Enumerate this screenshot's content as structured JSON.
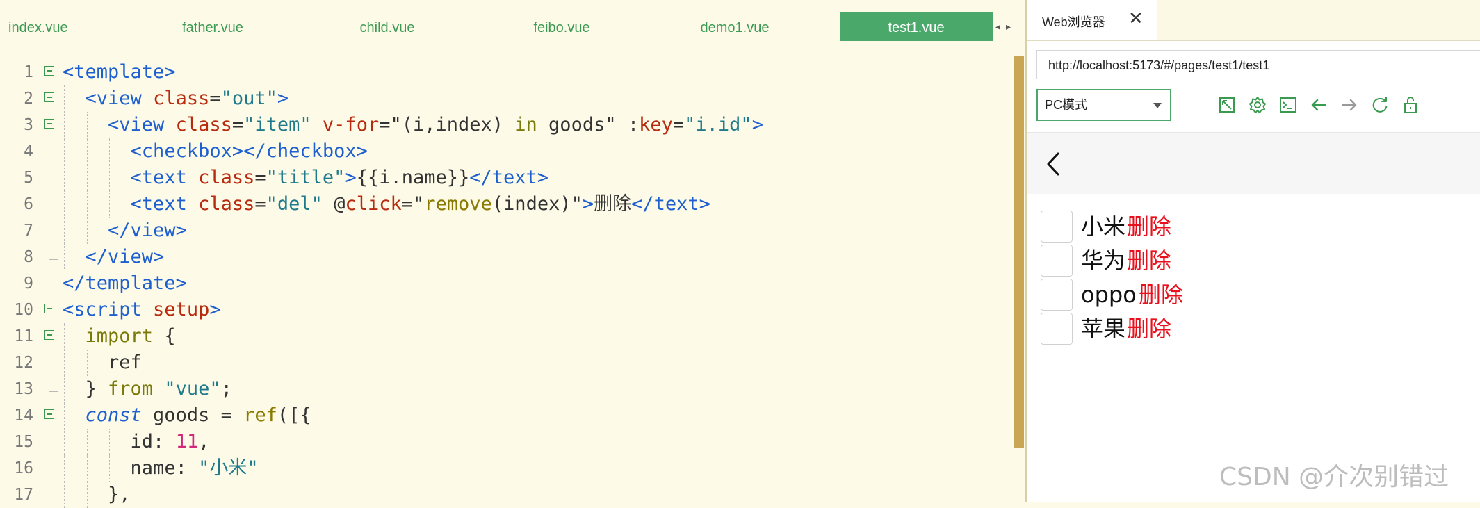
{
  "editor": {
    "tabs": [
      "index.vue",
      "father.vue",
      "child.vue",
      "feibo.vue",
      "demo1.vue",
      "test1.vue"
    ],
    "active_tab": "test1.vue",
    "tab_scroll_left": "◂",
    "tab_scroll_right": "▸",
    "line_numbers": [
      "1",
      "2",
      "3",
      "4",
      "5",
      "6",
      "7",
      "8",
      "9",
      "10",
      "11",
      "12",
      "13",
      "14",
      "15",
      "16",
      "17"
    ],
    "code_lines": [
      [
        [
          "t-tag",
          "<template>"
        ]
      ],
      [
        [
          "t-tag",
          "<view "
        ],
        [
          "t-attr",
          "class"
        ],
        [
          "t-txt",
          "="
        ],
        [
          "t-str",
          "\"out\""
        ],
        [
          "t-tag",
          ">"
        ]
      ],
      [
        [
          "t-tag",
          "<view "
        ],
        [
          "t-attr",
          "class"
        ],
        [
          "t-txt",
          "="
        ],
        [
          "t-str",
          "\"item\" "
        ],
        [
          "t-attr",
          "v-for"
        ],
        [
          "t-txt",
          "=\"(i,index) "
        ],
        [
          "t-kw",
          "in"
        ],
        [
          "t-txt",
          " goods\" :"
        ],
        [
          "t-attr",
          "key"
        ],
        [
          "t-txt",
          "="
        ],
        [
          "t-str",
          "\"i.id\""
        ],
        [
          "t-tag",
          ">"
        ]
      ],
      [
        [
          "t-tag",
          "<checkbox></checkbox>"
        ]
      ],
      [
        [
          "t-tag",
          "<text "
        ],
        [
          "t-attr",
          "class"
        ],
        [
          "t-txt",
          "="
        ],
        [
          "t-str",
          "\"title\""
        ],
        [
          "t-tag",
          ">"
        ],
        [
          "t-txt",
          "{{i.name}}"
        ],
        [
          "t-tag",
          "</text>"
        ]
      ],
      [
        [
          "t-tag",
          "<text "
        ],
        [
          "t-attr",
          "class"
        ],
        [
          "t-txt",
          "="
        ],
        [
          "t-str",
          "\"del\" "
        ],
        [
          "t-txt",
          "@"
        ],
        [
          "t-attr",
          "click"
        ],
        [
          "t-txt",
          "=\""
        ],
        [
          "t-fn",
          "remove"
        ],
        [
          "t-txt",
          "(index)\""
        ],
        [
          "t-tag",
          ">"
        ],
        [
          "t-txt",
          "删除"
        ],
        [
          "t-tag",
          "</text>"
        ]
      ],
      [
        [
          "t-tag",
          "</view>"
        ]
      ],
      [
        [
          "t-tag",
          "</view>"
        ]
      ],
      [
        [
          "t-tag",
          "</template>"
        ]
      ],
      [
        [
          "t-tag",
          "<script "
        ],
        [
          "t-attr",
          "setup"
        ],
        [
          "t-tag",
          ">"
        ]
      ],
      [
        [
          "t-kw",
          "import"
        ],
        [
          "t-txt",
          " {"
        ]
      ],
      [
        [
          "t-txt",
          "ref"
        ]
      ],
      [
        [
          "t-txt",
          "} "
        ],
        [
          "t-kw",
          "from"
        ],
        [
          "t-txt",
          " "
        ],
        [
          "t-str",
          "\"vue\""
        ],
        [
          "t-txt",
          ";"
        ]
      ],
      [
        [
          "t-const",
          "const"
        ],
        [
          "t-txt",
          " goods = "
        ],
        [
          "t-fn",
          "ref"
        ],
        [
          "t-txt",
          "([{"
        ]
      ],
      [
        [
          "t-txt",
          "id: "
        ],
        [
          "t-num",
          "11"
        ],
        [
          "t-txt",
          ","
        ]
      ],
      [
        [
          "t-txt",
          "name: "
        ],
        [
          "t-str",
          "\"小米\""
        ]
      ],
      [
        [
          "t-txt",
          "},"
        ]
      ]
    ]
  },
  "browser": {
    "tab_label": "Web浏览器",
    "tab_close": "✕",
    "url": "http://localhost:5173/#/pages/test1/test1",
    "mode_select": "PC模式",
    "toolbar_icons": [
      "popout-icon",
      "settings-gear-icon",
      "console-icon",
      "back-arrow-icon",
      "forward-arrow-icon",
      "refresh-icon",
      "unlock-icon"
    ],
    "colors": {
      "accent": "#4aa86a",
      "delete_red": "#e8101c",
      "tab_green": "#3c9a54"
    },
    "items": [
      {
        "name": "小米",
        "del": "删除"
      },
      {
        "name": "华为",
        "del": "删除"
      },
      {
        "name": "oppo",
        "del": "删除"
      },
      {
        "name": "苹果",
        "del": "删除"
      }
    ],
    "watermark": "CSDN @介次别错过"
  }
}
